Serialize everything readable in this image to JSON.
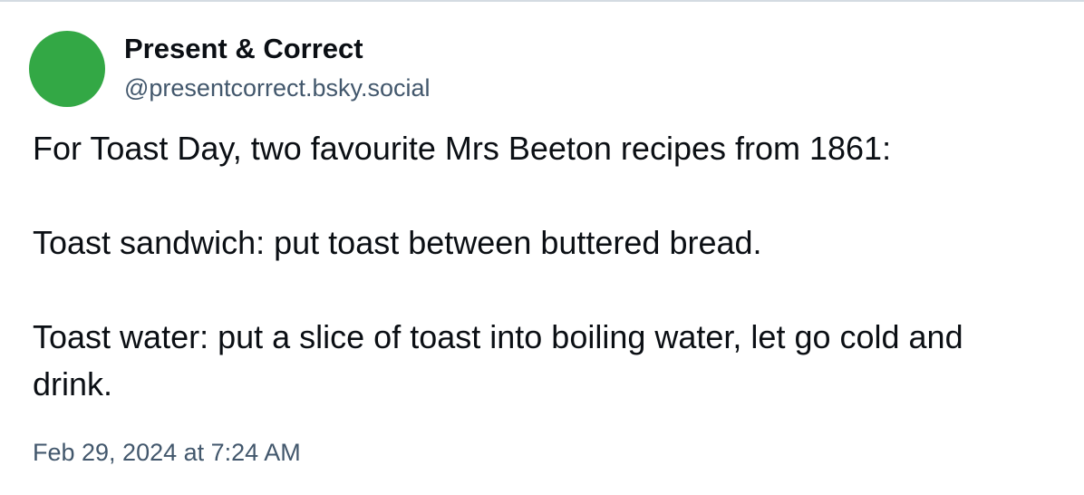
{
  "author": {
    "display_name": "Present & Correct",
    "handle": "@presentcorrect.bsky.social",
    "avatar_color": "#33a845"
  },
  "post": {
    "paragraphs": [
      "For Toast Day, two favourite Mrs Beeton recipes from 1861:",
      "Toast sandwich: put toast between buttered bread.",
      "Toast water: put a slice of toast into boiling water, let go cold and drink."
    ],
    "timestamp": "Feb 29, 2024 at 7:24 AM"
  },
  "colors": {
    "text_primary": "#0b0f14",
    "text_secondary": "#42576c",
    "divider": "#d4dbe2"
  }
}
